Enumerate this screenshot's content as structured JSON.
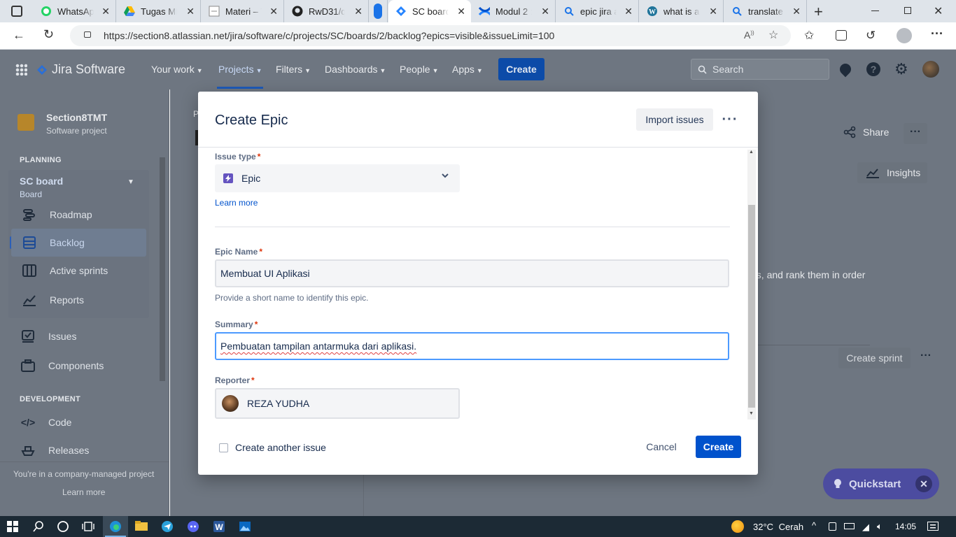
{
  "browser": {
    "tabs": [
      {
        "title": "WhatsApp",
        "icon": "whatsapp-icon"
      },
      {
        "title": "Tugas MP",
        "icon": "google-drive-icon"
      },
      {
        "title": "Materi – T",
        "icon": "document-icon"
      },
      {
        "title": "RwD31/qe",
        "icon": "github-icon"
      },
      {
        "title": "",
        "icon": "blue-pill-icon"
      },
      {
        "title": "SC board",
        "icon": "jira-icon",
        "active": true
      },
      {
        "title": "Modul 2 :",
        "icon": "confluence-icon"
      },
      {
        "title": "epic jira a",
        "icon": "search-icon"
      },
      {
        "title": "what is an",
        "icon": "wordpress-icon"
      },
      {
        "title": "translate -",
        "icon": "search-icon"
      }
    ],
    "url": "https://section8.atlassian.net/jira/software/c/projects/SC/boards/2/backlog?epics=visible&issueLimit=100"
  },
  "jira_nav": {
    "product": "Jira Software",
    "items": [
      "Your work",
      "Projects",
      "Filters",
      "Dashboards",
      "People",
      "Apps"
    ],
    "create": "Create",
    "search_placeholder": "Search"
  },
  "sidebar": {
    "project_name": "Section8TMT",
    "project_type": "Software project",
    "planning_heading": "PLANNING",
    "board_name": "SC board",
    "board_sub": "Board",
    "planning_items": [
      "Roadmap",
      "Backlog",
      "Active sprints",
      "Reports"
    ],
    "other_items": [
      "Issues",
      "Components"
    ],
    "development_heading": "DEVELOPMENT",
    "dev_items": [
      "Code",
      "Releases"
    ],
    "footer_text": "You're in a company-managed project",
    "learn_more": "Learn more"
  },
  "background": {
    "share": "Share",
    "insights": "Insights",
    "hint_text": "es, and rank them in order",
    "create_sprint": "Create sprint",
    "breadcrumb_initial": "P"
  },
  "modal": {
    "title": "Create Epic",
    "import_issues": "Import issues",
    "issue_type_label": "Issue type",
    "issue_type_value": "Epic",
    "learn_more": "Learn more",
    "epic_name_label": "Epic Name",
    "epic_name_value": "Membuat UI Aplikasi",
    "epic_name_help": "Provide a short name to identify this epic.",
    "summary_label": "Summary",
    "summary_value": "Pembuatan tampilan antarmuka dari aplikasi.",
    "reporter_label": "Reporter",
    "reporter_value": "REZA YUDHA",
    "required_marker": "*",
    "create_another": "Create another issue",
    "cancel": "Cancel",
    "create": "Create"
  },
  "quickstart": {
    "label": "Quickstart"
  },
  "taskbar": {
    "temperature": "32°C",
    "weather": "Cerah",
    "time": "14:05"
  },
  "colors": {
    "jira_blue": "#0052cc",
    "required_red": "#de350b",
    "epic_purple": "#6554c0",
    "overlay": "#6e7681"
  }
}
